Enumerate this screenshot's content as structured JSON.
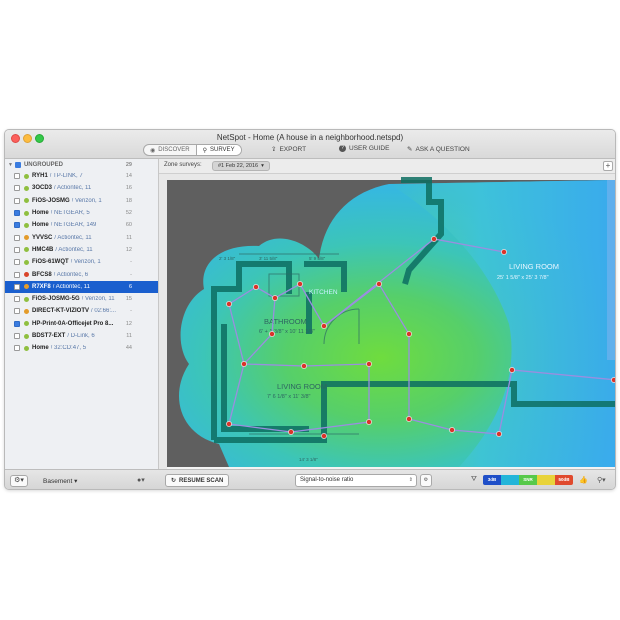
{
  "window": {
    "title": "NetSpot - Home (A house in a neighborhood.netspd)",
    "mode_discover": "DISCOVER",
    "mode_survey": "SURVEY",
    "export_label": "EXPORT",
    "user_guide_label": "USER GUIDE",
    "ask_label": "ASK A QUESTION"
  },
  "sidebar": {
    "group_label": "UNGROUPED",
    "group_count": "29",
    "networks": [
      {
        "ssid": "RYH1",
        "vendor": "TP-LINK, 7",
        "count": "14",
        "checked": false,
        "color": "#8fbf3f"
      },
      {
        "ssid": "3OCD3",
        "vendor": "Actiontec, 11",
        "count": "16",
        "checked": false,
        "color": "#8fbf3f"
      },
      {
        "ssid": "FiOS-JOSMG",
        "vendor": "Verizon, 1",
        "count": "18",
        "checked": false,
        "color": "#8fbf3f"
      },
      {
        "ssid": "Home",
        "vendor": "NETGEAR, 5",
        "count": "52",
        "checked": true,
        "color": "#8fbf3f"
      },
      {
        "ssid": "Home",
        "vendor": "NETGEAR, 149",
        "count": "60",
        "checked": true,
        "color": "#8fbf3f"
      },
      {
        "ssid": "YVVSC",
        "vendor": "Actiontec, 11",
        "count": "11",
        "checked": false,
        "color": "#e39b2a"
      },
      {
        "ssid": "HMC4B",
        "vendor": "Actiontec, 11",
        "count": "12",
        "checked": false,
        "color": "#8fbf3f"
      },
      {
        "ssid": "FiOS-61WQT",
        "vendor": "Verizon, 1",
        "count": "-",
        "checked": false,
        "color": "#8fbf3f"
      },
      {
        "ssid": "BFCS8",
        "vendor": "Actiontec, 6",
        "count": "-",
        "checked": false,
        "color": "#d9452b"
      },
      {
        "ssid": "R7XF8",
        "vendor": "Actiontec, 11",
        "count": "6",
        "checked": false,
        "color": "#e39b2a",
        "selected": true
      },
      {
        "ssid": "FiOS-JOSMG-5G",
        "vendor": "Verizon, 11",
        "count": "15",
        "checked": false,
        "color": "#8fbf3f"
      },
      {
        "ssid": "DIRECT-KT-VIZIOTV",
        "vendor": "02:66:...",
        "count": "-",
        "checked": false,
        "color": "#e39b2a"
      },
      {
        "ssid": "HP-Print-0A-Officejet Pro 8...",
        "vendor": "",
        "count": "12",
        "checked": true,
        "color": "#8fbf3f"
      },
      {
        "ssid": "BDST7-EXT",
        "vendor": "D-Link, 6",
        "count": "11",
        "checked": false,
        "color": "#8fbf3f"
      },
      {
        "ssid": "Home",
        "vendor": "32:CD:47, 5",
        "count": "44",
        "checked": false,
        "color": "#8fbf3f"
      }
    ]
  },
  "survey": {
    "label": "Zone surveys:",
    "current": "#1 Feb 22, 2016"
  },
  "map": {
    "rooms": [
      {
        "name": "BATHROOM",
        "dims": "6' + 1 3/8\" x 10' 11 1/8\""
      },
      {
        "name": "LIVING ROOM",
        "dims": "7' 6 1/8\" x 11' 3/8\""
      },
      {
        "name": "LIVING ROOM",
        "dims": "25' 1 5/8\" x 25' 3 7/8\""
      },
      {
        "name": "KITCHEN",
        "dims": ""
      }
    ],
    "dim_labels": [
      "2' 3 1/8\"",
      "3' 11 5/8\"",
      "5' 9 5/8\"",
      "14' 3 1/8\""
    ]
  },
  "statusbar": {
    "floor": "Basement",
    "resume_label": "RESUME SCAN",
    "visualization": "Signal-to-noise ratio",
    "legend": [
      "3dB",
      "",
      "SNR",
      "",
      "50dB"
    ],
    "legend_colors": [
      "#1f4fc8",
      "#23b5d9",
      "#57c94a",
      "#e8d33a",
      "#e04a2e"
    ]
  }
}
